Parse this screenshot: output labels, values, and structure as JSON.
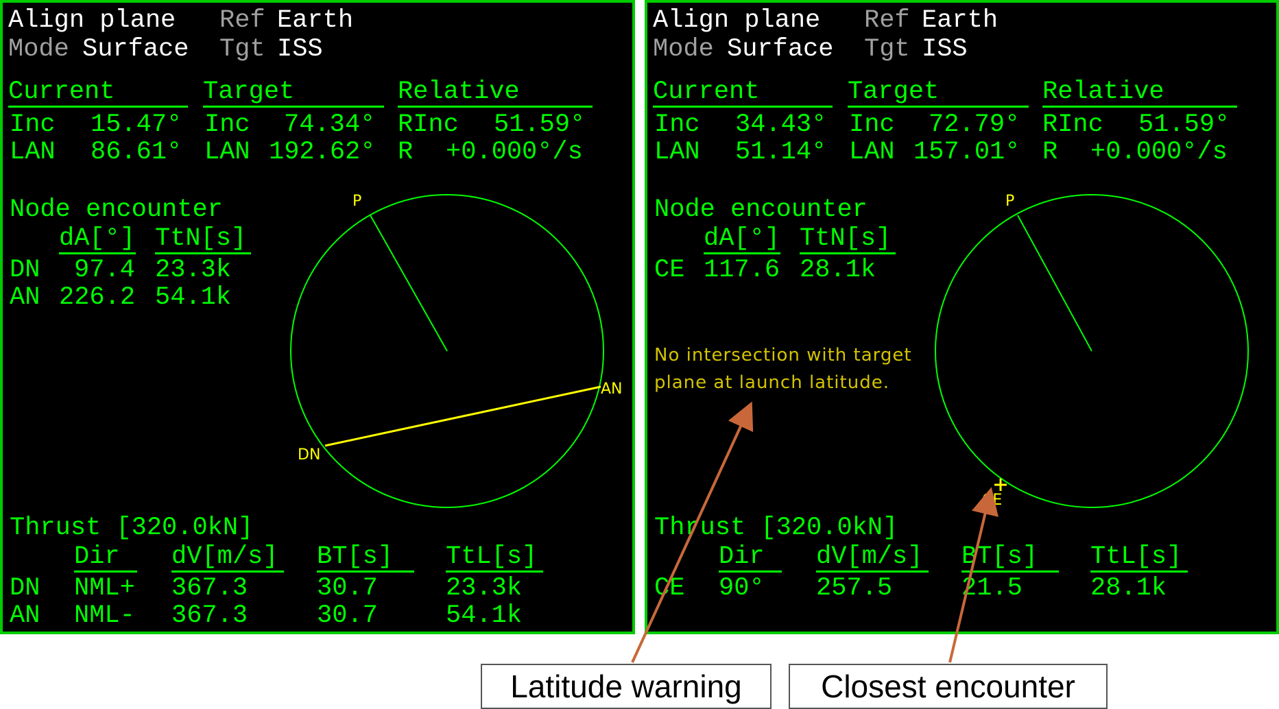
{
  "colors": {
    "mfd_text": "#00ff00",
    "mfd_border": "#00cc00",
    "header_text": "#ffffff",
    "header_dim": "#a0a0a0",
    "marker_yellow": "#ffff00",
    "warning_text": "#d4c400",
    "arrow": "#c8683a"
  },
  "left": {
    "title": "Align plane",
    "ref_label": "Ref",
    "ref_value": "Earth",
    "mode_label": "Mode",
    "mode_value": "Surface",
    "tgt_label": "Tgt",
    "tgt_value": "ISS",
    "current_header": "Current",
    "target_header": "Target",
    "relative_header": "Relative",
    "cur_inc_label": "Inc",
    "cur_inc_value": "15.47°",
    "cur_lan_label": "LAN",
    "cur_lan_value": "86.61°",
    "tgt_inc_label": "Inc",
    "tgt_inc_value": "74.34°",
    "tgt_lan_label": "LAN",
    "tgt_lan_value": "192.62°",
    "rinc_label": "RInc",
    "rinc_value": "51.59°",
    "r_label": "R",
    "r_value": "+0.000°/s",
    "node_title": "Node encounter",
    "node_col_da": "dA[°]",
    "node_col_ttn": "TtN[s]",
    "node_rows": [
      {
        "name": "DN",
        "da": "97.4",
        "ttn": "23.3k"
      },
      {
        "name": "AN",
        "da": "226.2",
        "ttn": "54.1k"
      }
    ],
    "thrust_title": "Thrust [320.0kN]",
    "thrust_cols": {
      "dir": "Dir",
      "dv": "dV[m/s]",
      "bt": "BT[s]",
      "ttl": "TtL[s]"
    },
    "thrust_rows": [
      {
        "name": "DN",
        "dir": "NML+",
        "dv": "367.3",
        "bt": "30.7",
        "ttl": "23.3k"
      },
      {
        "name": "AN",
        "dir": "NML-",
        "dv": "367.3",
        "bt": "30.7",
        "ttl": "54.1k"
      }
    ],
    "plot": {
      "p_label": "P",
      "an_label": "AN",
      "dn_label": "DN"
    }
  },
  "right": {
    "title": "Align plane",
    "ref_label": "Ref",
    "ref_value": "Earth",
    "mode_label": "Mode",
    "mode_value": "Surface",
    "tgt_label": "Tgt",
    "tgt_value": "ISS",
    "current_header": "Current",
    "target_header": "Target",
    "relative_header": "Relative",
    "cur_inc_label": "Inc",
    "cur_inc_value": "34.43°",
    "cur_lan_label": "LAN",
    "cur_lan_value": "51.14°",
    "tgt_inc_label": "Inc",
    "tgt_inc_value": "72.79°",
    "tgt_lan_label": "LAN",
    "tgt_lan_value": "157.01°",
    "rinc_label": "RInc",
    "rinc_value": "51.59°",
    "r_label": "R",
    "r_value": "+0.000°/s",
    "node_title": "Node encounter",
    "node_col_da": "dA[°]",
    "node_col_ttn": "TtN[s]",
    "node_rows": [
      {
        "name": "CE",
        "da": "117.6",
        "ttn": "28.1k"
      }
    ],
    "warning_line1": "No intersection with target",
    "warning_line2": "plane at launch latitude.",
    "thrust_title": "Thrust [320.0kN]",
    "thrust_cols": {
      "dir": "Dir",
      "dv": "dV[m/s]",
      "bt": "BT[s]",
      "ttl": "TtL[s]"
    },
    "thrust_rows": [
      {
        "name": "CE",
        "dir": "90°",
        "dv": "257.5",
        "bt": "21.5",
        "ttl": "28.1k"
      }
    ],
    "plot": {
      "p_label": "P",
      "ce_label": "CE"
    }
  },
  "annotations": {
    "latitude_warning": "Latitude warning",
    "closest_encounter": "Closest encounter"
  }
}
